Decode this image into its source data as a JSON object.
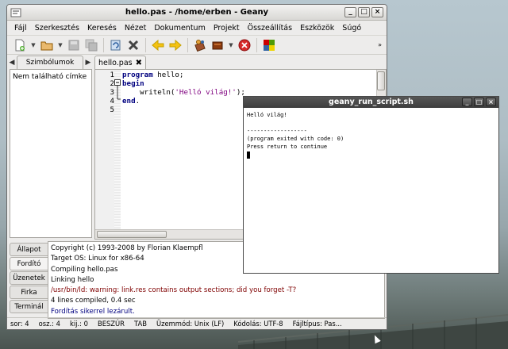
{
  "window": {
    "title": "hello.pas - /home/erben - Geany",
    "controls": {
      "minimize": "_",
      "maximize": "□",
      "close": "×"
    }
  },
  "menubar": [
    "Fájl",
    "Szerkesztés",
    "Keresés",
    "Nézet",
    "Dokumentum",
    "Projekt",
    "Összeállítás",
    "Eszközök",
    "Súgó"
  ],
  "toolbar": {
    "icons": [
      "new-file-icon",
      "open-folder-icon",
      "save-icon",
      "save-all-icon",
      "revert-icon",
      "close-file-icon",
      "back-arrow-icon",
      "forward-arrow-icon",
      "compile-icon",
      "build-icon",
      "stop-icon",
      "color-chooser-icon"
    ],
    "overflow": "»"
  },
  "sidebar": {
    "tab_label": "Szimbólumok",
    "empty_text": "Nem található címke"
  },
  "editor": {
    "tab_label": "hello.pas",
    "tab_close": "✖",
    "lines": [
      {
        "num": "1",
        "tokens": [
          {
            "t": "program",
            "c": "kw"
          },
          {
            "t": " hello;",
            "c": ""
          }
        ]
      },
      {
        "num": "2",
        "tokens": [
          {
            "t": "begin",
            "c": "kw"
          }
        ]
      },
      {
        "num": "3",
        "tokens": [
          {
            "t": "    writeln(",
            "c": ""
          },
          {
            "t": "'Helló világ!'",
            "c": "str"
          },
          {
            "t": ");",
            "c": ""
          }
        ]
      },
      {
        "num": "4",
        "tokens": [
          {
            "t": "end",
            "c": "kw"
          },
          {
            "t": ".",
            "c": ""
          }
        ]
      },
      {
        "num": "5",
        "tokens": []
      }
    ]
  },
  "message_tabs": [
    "Állapot",
    "Fordító",
    "Üzenetek",
    "Firka",
    "Terminál"
  ],
  "active_message_tab": 1,
  "compiler_output": [
    {
      "text": "Copyright (c) 1993-2008 by Florian Klaempfl",
      "style": ""
    },
    {
      "text": "Target OS: Linux for x86-64",
      "style": ""
    },
    {
      "text": "Compiling hello.pas",
      "style": ""
    },
    {
      "text": "Linking hello",
      "style": ""
    },
    {
      "text": "/usr/bin/ld: warning: link.res contains output sections; did you forget -T?",
      "style": "err"
    },
    {
      "text": "4 lines compiled, 0.4 sec",
      "style": ""
    },
    {
      "text": "Fordítás sikerrel lezárult.",
      "style": "ok"
    }
  ],
  "statusbar": [
    "sor: 4",
    "osz.: 4",
    "kij.: 0",
    "BESZÚR",
    "TAB",
    "Üzemmód: Unix (LF)",
    "Kódolás: UTF-8",
    "Fájltípus: Pas..."
  ],
  "terminal": {
    "title": "geany_run_script.sh",
    "lines": [
      "Helló világ!",
      "",
      "------------------",
      "(program exited with code: 0)",
      "Press return to continue"
    ]
  }
}
